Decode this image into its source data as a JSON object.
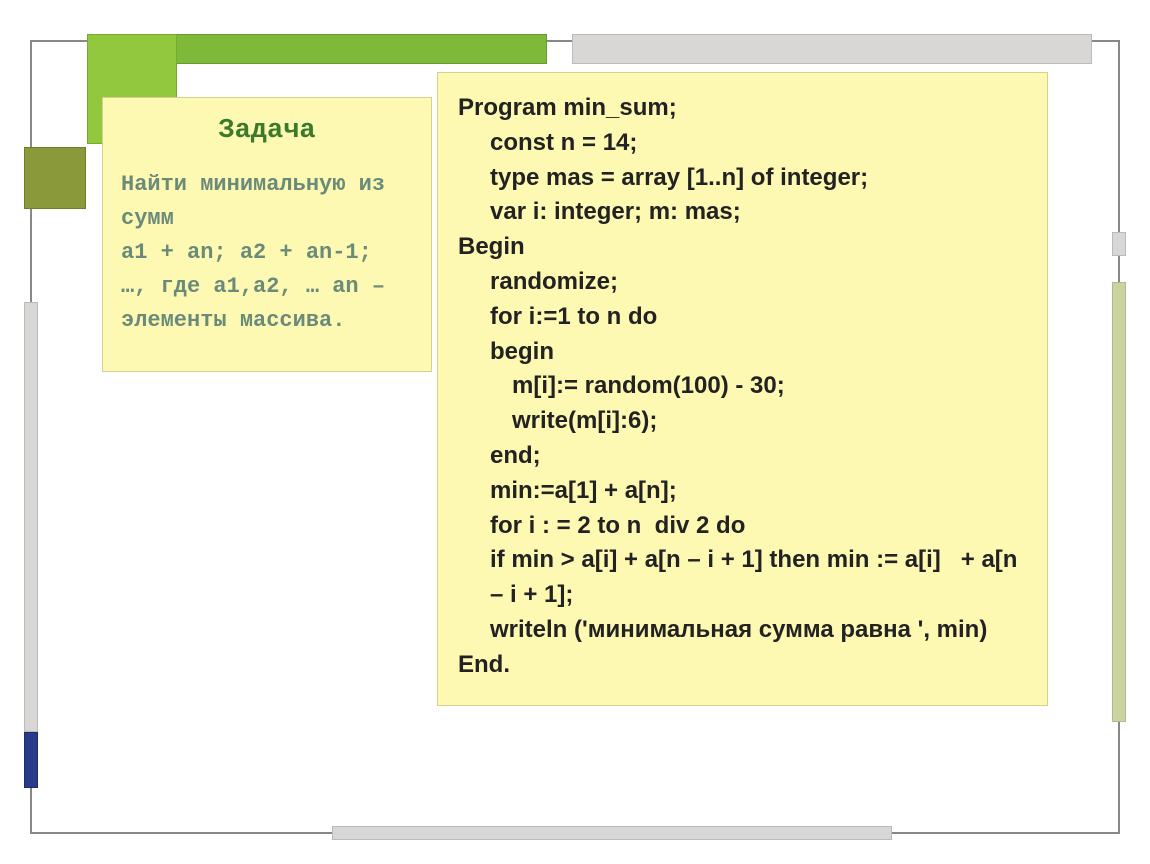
{
  "title": "Задача",
  "task_text": "Найти минимальную из сумм\nа1 + аn; a2 + an-1;\n…, где a1,a2, … an – элементы массива.",
  "code": {
    "lines": [
      {
        "t": "Program min_sum;",
        "i": 0
      },
      {
        "t": "const n = 14;",
        "i": 1
      },
      {
        "t": "type mas = array [1..n] of integer;",
        "i": 1
      },
      {
        "t": "var i: integer; m: mas;",
        "i": 1
      },
      {
        "t": "Begin",
        "i": 0
      },
      {
        "t": "randomize;",
        "i": 1
      },
      {
        "t": "for i:=1 to n do",
        "i": 1
      },
      {
        "t": "begin",
        "i": 1
      },
      {
        "t": "m[i]:= random(100) - 30;",
        "i": 2
      },
      {
        "t": "write(m[i]:6);",
        "i": 2
      },
      {
        "t": "end;",
        "i": 1
      },
      {
        "t": "min:=a[1] + a[n];",
        "i": 1
      },
      {
        "t": "for i : = 2 to n  div 2 do",
        "i": 1
      },
      {
        "t": "if min > a[i] + a[n – i + 1] then min := a[i]   + a[n – i + 1];",
        "i": 1
      },
      {
        "t": "writeln ('минимальная сумма равна ', min)",
        "i": 1
      },
      {
        "t": "End.",
        "i": 0
      }
    ]
  }
}
